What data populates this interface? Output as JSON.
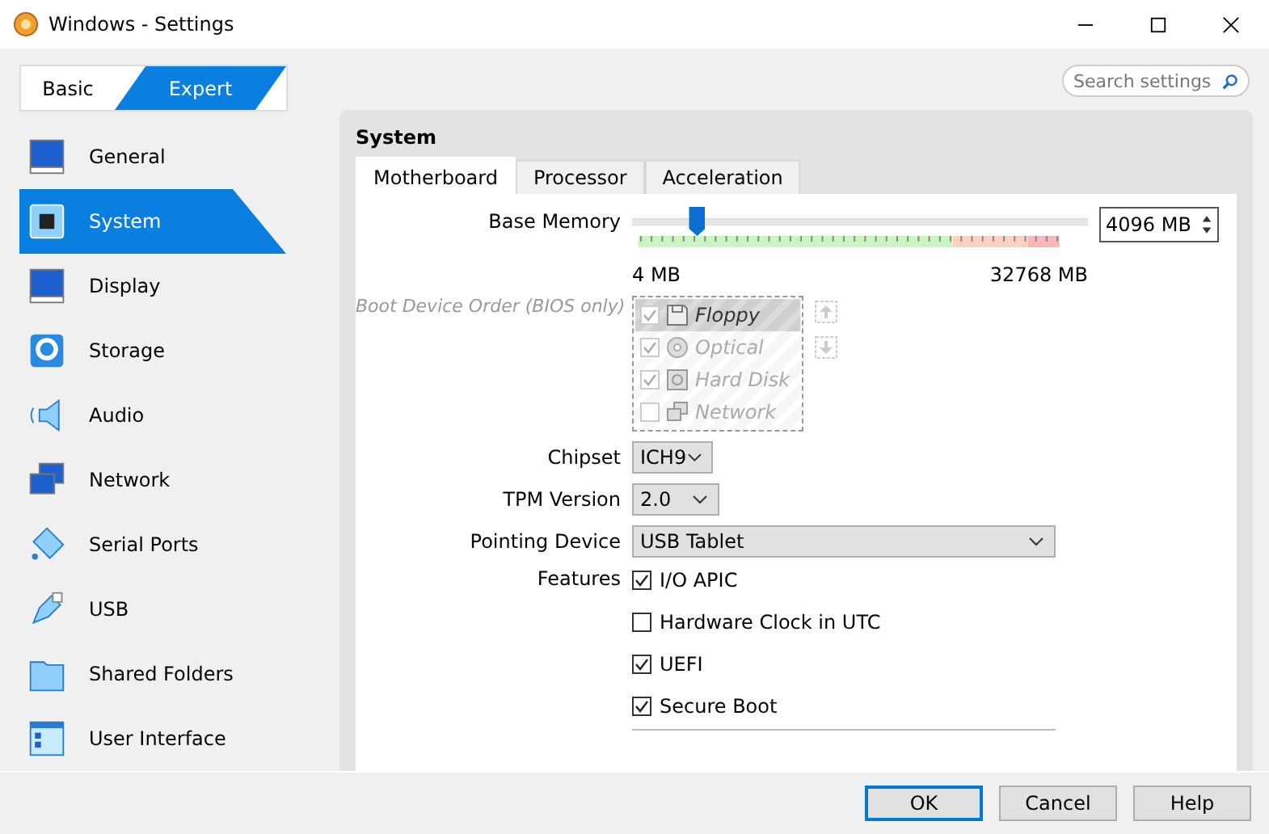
{
  "window": {
    "title": "Windows - Settings"
  },
  "mode_tabs": [
    {
      "label": "Basic",
      "selected": false
    },
    {
      "label": "Expert",
      "selected": true
    }
  ],
  "search": {
    "placeholder": "Search settings"
  },
  "sidebar": {
    "items": [
      {
        "label": "General",
        "kind": "general",
        "selected": false
      },
      {
        "label": "System",
        "kind": "system",
        "selected": true
      },
      {
        "label": "Display",
        "kind": "display",
        "selected": false
      },
      {
        "label": "Storage",
        "kind": "storage",
        "selected": false
      },
      {
        "label": "Audio",
        "kind": "audio",
        "selected": false
      },
      {
        "label": "Network",
        "kind": "network",
        "selected": false
      },
      {
        "label": "Serial Ports",
        "kind": "serial",
        "selected": false
      },
      {
        "label": "USB",
        "kind": "usb",
        "selected": false
      },
      {
        "label": "Shared Folders",
        "kind": "folder",
        "selected": false
      },
      {
        "label": "User Interface",
        "kind": "ui",
        "selected": false
      }
    ]
  },
  "section": {
    "title": "System"
  },
  "tabs": [
    {
      "label": "Motherboard",
      "selected": true
    },
    {
      "label": "Processor",
      "selected": false
    },
    {
      "label": "Acceleration",
      "selected": false
    }
  ],
  "base_memory": {
    "label": "Base Memory",
    "level": 0.125,
    "value": "4096 MB",
    "min_label": "4 MB",
    "max_label": "32768 MB"
  },
  "boot_order": {
    "label": "Boot Device Order (BIOS only)",
    "disabled": true,
    "items": [
      {
        "label": "Floppy",
        "kind": "floppy",
        "checked": true,
        "selected": true
      },
      {
        "label": "Optical",
        "kind": "optical",
        "checked": true,
        "selected": false
      },
      {
        "label": "Hard Disk",
        "kind": "disk",
        "checked": true,
        "selected": false
      },
      {
        "label": "Network",
        "kind": "network",
        "checked": false,
        "selected": false
      }
    ]
  },
  "chipset": {
    "label": "Chipset",
    "value": "ICH9"
  },
  "tpm": {
    "label": "TPM Version",
    "value": "2.0"
  },
  "pointing": {
    "label": "Pointing Device",
    "value": "USB Tablet"
  },
  "features": {
    "label": "Features",
    "items": [
      {
        "label": "I/O APIC",
        "checked": true
      },
      {
        "label": "Hardware Clock in UTC",
        "checked": false
      },
      {
        "label": "UEFI",
        "checked": true
      },
      {
        "label": "Secure Boot",
        "checked": true
      }
    ]
  },
  "buttons": [
    {
      "label": "OK",
      "default": true
    },
    {
      "label": "Cancel",
      "default": false
    },
    {
      "label": "Help",
      "default": false
    }
  ]
}
